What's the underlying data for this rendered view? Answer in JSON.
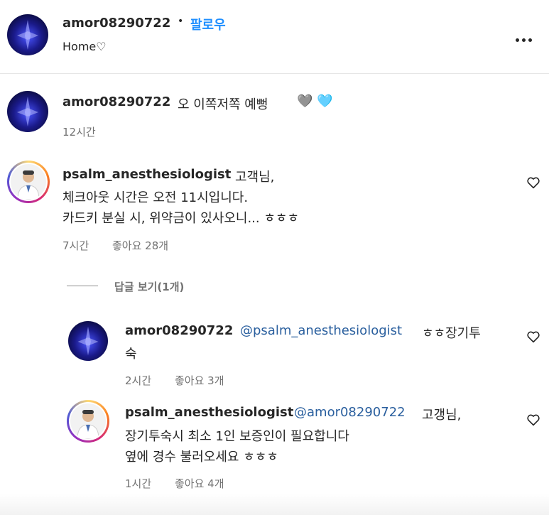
{
  "header": {
    "username": "amor08290722",
    "separator": "•",
    "follow_label": "팔로우",
    "subtitle": "Home♡",
    "more_icon": "more-horizontal-icon"
  },
  "caption": {
    "username": "amor08290722",
    "text": "오 이쪽저쪽 예뻥",
    "emojis": "🩶 🩵",
    "time": "12시간"
  },
  "comments": [
    {
      "username": "psalm_anesthesiologist",
      "lines": [
        "고객님,",
        "체크아웃 시간은 오전 11시입니다.",
        "카드키 분실 시, 위약금이 있사오니... ㅎㅎㅎ"
      ],
      "time": "7시간",
      "likes": "좋아요 28개"
    }
  ],
  "view_replies_label": "답글 보기(1개)",
  "replies": [
    {
      "username": "amor08290722",
      "mention": "@psalm_anesthesiologist",
      "text_after": "ㅎㅎ장기투",
      "line2": "숙",
      "time": "2시간",
      "likes": "좋아요 3개"
    },
    {
      "username": "psalm_anesthesiologist",
      "mention": "@amor08290722",
      "text_after": "고갱님,",
      "line2": "장기투숙시 최소 1인 보증인이 필요합니다",
      "line3": "옆에 경수 불러오세요 ㅎㅎㅎ",
      "time": "1시간",
      "likes": "좋아요 4개"
    }
  ],
  "colors": {
    "text": "#262626",
    "muted": "#737373",
    "link": "#1f8fff",
    "mention": "#2a5f9e"
  }
}
